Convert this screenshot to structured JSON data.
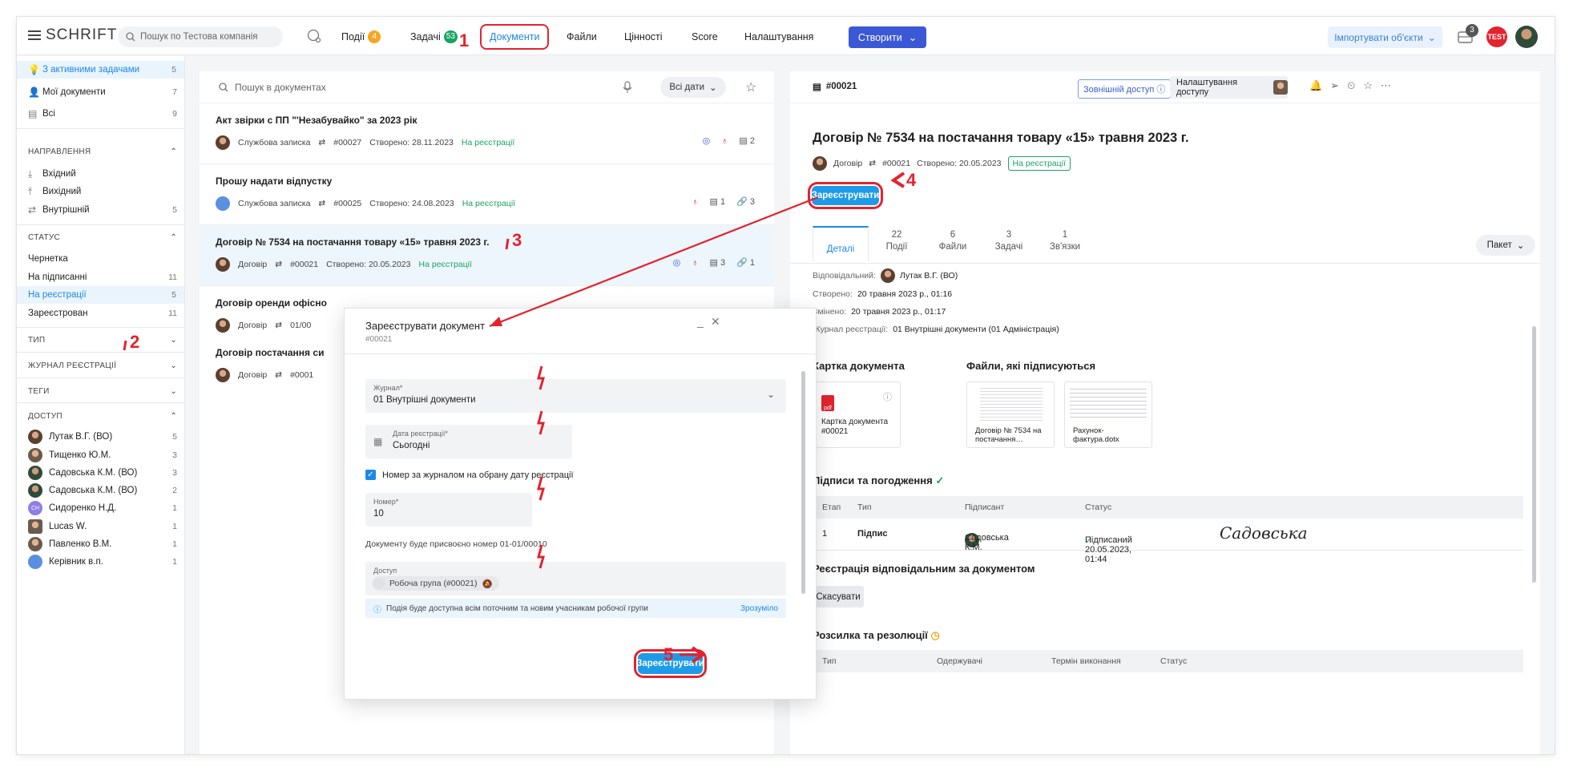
{
  "topbar": {
    "logo": "SCHRIFT",
    "search_placeholder": "Пошук по Тестова компанія",
    "nav": [
      {
        "label": "Події",
        "badge": "4",
        "badge_color": "#f5a623"
      },
      {
        "label": "Задачі",
        "badge": "53",
        "badge_color": "#19a361"
      },
      {
        "label": "Документи"
      },
      {
        "label": "Файли"
      },
      {
        "label": "Цінності"
      },
      {
        "label": "Score"
      },
      {
        "label": "Налаштування"
      }
    ],
    "create_label": "Створити",
    "import_label": "Імпортувати об'єкти",
    "notif_count": "3",
    "user_badge": "TEST"
  },
  "sidebar": {
    "top_items": [
      {
        "label": "З активними задачами",
        "count": "5"
      },
      {
        "label": "Мої документи",
        "count": "7"
      },
      {
        "label": "Всі",
        "count": "9"
      }
    ],
    "direction_title": "НАПРАВЛЕННЯ",
    "direction_items": [
      {
        "label": "Вхідний",
        "count": ""
      },
      {
        "label": "Вихідний",
        "count": ""
      },
      {
        "label": "Внутрішній",
        "count": "5"
      }
    ],
    "status_title": "СТАТУС",
    "status_items": [
      {
        "label": "Чернетка",
        "count": ""
      },
      {
        "label": "На підписанні",
        "count": "11"
      },
      {
        "label": "На реєстрації",
        "count": "5"
      },
      {
        "label": "Зареєстрован",
        "count": "11"
      }
    ],
    "type_title": "ТИП",
    "journal_title": "ЖУРНАЛ РЕЄСТРАЦІЇ",
    "tags_title": "ТЕГИ",
    "access_title": "ДОСТУП",
    "access_items": [
      {
        "label": "Лутак В.Г. (ВО)",
        "count": "5"
      },
      {
        "label": "Тищенко Ю.М.",
        "count": "3"
      },
      {
        "label": "Садовська К.М. (ВО)",
        "count": "3"
      },
      {
        "label": "Садовська К.М. (ВО)",
        "count": "2"
      },
      {
        "label": "Сидоренко Н.Д.",
        "count": "1",
        "initials": "СН"
      },
      {
        "label": "Lucas W.",
        "count": "1"
      },
      {
        "label": "Павленко В.М.",
        "count": "1"
      },
      {
        "label": "Керівник в.п.",
        "count": "1"
      }
    ]
  },
  "list": {
    "search_placeholder": "Пошук в документах",
    "dates_label": "Всі дати",
    "docs": [
      {
        "title": "Акт звірки с ПП \"'Незабувайко\" за 2023 рік",
        "type": "Службова записка",
        "num": "#00027",
        "created": "Створено: 28.11.2023",
        "status": "На реєстрації",
        "files": "2"
      },
      {
        "title": "Прошу надати відпустку",
        "type": "Службова записка",
        "num": "#00025",
        "created": "Створено: 24.08.2023",
        "status": "На реєстрації",
        "files": "1",
        "links": "3"
      },
      {
        "title": "Договір № 7534 на постачання товару «15» травня 2023 г.",
        "type": "Договір",
        "num": "#00021",
        "created": "Створено: 20.05.2023",
        "status": "На реєстрації",
        "files": "3",
        "links": "1"
      },
      {
        "title": "Договір оренди офісно",
        "type": "Договір",
        "num": "01/00"
      },
      {
        "title": "Договір постачання си",
        "type": "Договір",
        "num": "#0001"
      }
    ]
  },
  "detail": {
    "doc_num": "#00021",
    "external_access": "Зовнішній доступ",
    "access_settings": "Налаштування доступу",
    "title": "Договір № 7534 на постачання товару «15» травня 2023 г.",
    "type": "Договір",
    "num": "#00021",
    "created": "Створено: 20.05.2023",
    "status": "На реєстрації",
    "register_label": "Зареєструвати",
    "tabs": [
      {
        "count": "",
        "label": "Деталі"
      },
      {
        "count": "22",
        "label": "Події"
      },
      {
        "count": "6",
        "label": "Файли"
      },
      {
        "count": "3",
        "label": "Задачі"
      },
      {
        "count": "1",
        "label": "Зв'язки"
      }
    ],
    "packet_label": "Пакет",
    "responsible_label": "Відповідальний:",
    "responsible": "Лутак В.Г. (ВО)",
    "created_label": "Створено:",
    "created_full": "20 травня 2023 р., 01:16",
    "changed_label": "Змінено:",
    "changed_full": "20 травня 2023 р., 01:17",
    "journal_label": "Журнал реєстрації:",
    "journal": "01 Внутрішні документи (01 Адміністрація)",
    "card_title": "Картка документа",
    "files_title": "Файли, які підписуються",
    "card_file": "Картка документа #00021",
    "pdf_label": "pdf",
    "file1": "Договір № 7534 на постачання…",
    "file2": "Рахунок-фактура.dotx",
    "sign_title": "Підписи та погодження",
    "sign_cols": [
      "Етап",
      "Тип",
      "Підписант",
      "Статус"
    ],
    "sign_row": {
      "stage": "1",
      "type": "Підпис",
      "signer": "Садовська К.М.",
      "status": "Підписаний 20.05.2023, 01:44",
      "signature": "Садовська"
    },
    "reg_resp_title": "Реєстрація відповідальним за документом",
    "cancel_label": "Скасувати",
    "mailing_title": "Розсилка та резолюції",
    "mailing_cols": [
      "Тип",
      "Одержувачі",
      "Термін виконання",
      "Статус"
    ]
  },
  "modal": {
    "title": "Зареєструвати документ",
    "subtitle": "#00021",
    "journal_label": "Журнал*",
    "journal_value": "01 Внутрішні документи",
    "date_label": "Дата реєстрації*",
    "date_value": "Сьогодні",
    "checkbox_label": "Номер за журналом на обрану дату реєстрації",
    "checkbox_checked": true,
    "number_label": "Номер*",
    "number_value": "10",
    "assign_note": "Документу буде присвоєно номер 01-01/00010",
    "access_label": "Доступ",
    "access_chip": "Робоча група (#00021)",
    "info_text": "Подія буде доступна всім поточним та новим учасникам робочої групи",
    "info_ok": "Зрозуміло",
    "submit_label": "Зареєструвати"
  },
  "annotations": [
    "1",
    "2",
    "3",
    "4",
    "5"
  ]
}
